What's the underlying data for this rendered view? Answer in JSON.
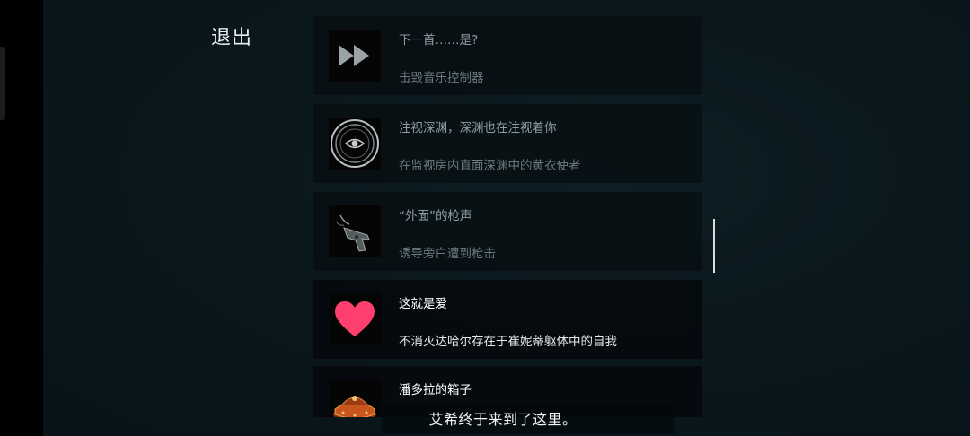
{
  "menu": {
    "exit_label": "退出"
  },
  "achievements": [
    {
      "title": "下一首……是?",
      "desc": "击毁音乐控制器",
      "icon": "fast-forward-icon",
      "unlocked": false
    },
    {
      "title": "注视深渊，深渊也在注视着你",
      "desc": "在监视房内直面深渊中的黄衣使者",
      "icon": "eye-icon",
      "unlocked": false
    },
    {
      "title": "“外面”的枪声",
      "desc": "诱导旁白遭到枪击",
      "icon": "pistol-icon",
      "unlocked": false
    },
    {
      "title": "这就是爱",
      "desc": "不消灭达哈尔存在于崔妮蒂躯体中的自我",
      "icon": "heart-icon",
      "unlocked": true
    },
    {
      "title": "潘多拉的箱子",
      "desc": "",
      "icon": "pandora-box-icon",
      "unlocked": true
    }
  ],
  "subtitle": "艾希终于来到了这里。",
  "colors": {
    "background": "#0a171c",
    "heart": "#ff3f6e",
    "box": "#c8541e"
  }
}
